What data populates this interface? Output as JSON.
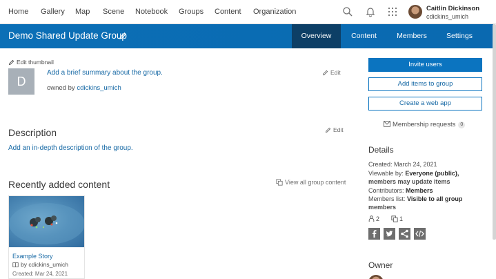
{
  "nav": {
    "links": [
      "Home",
      "Gallery",
      "Map",
      "Scene",
      "Notebook",
      "Groups",
      "Content",
      "Organization"
    ],
    "user_name": "Caitlin Dickinson",
    "user_id": "cdickins_umich"
  },
  "group": {
    "title": "Demo Shared Update Group",
    "tabs": [
      "Overview",
      "Content",
      "Members",
      "Settings"
    ],
    "active_tab": "Overview"
  },
  "overview": {
    "edit_thumbnail": "Edit thumbnail",
    "thumbnail_letter": "D",
    "summary_link": "Add a brief summary about the group.",
    "owned_by_label": "owned by",
    "owner_id": "cdickins_umich",
    "edit_label": "Edit",
    "description_title": "Description",
    "description_link": "Add an in-depth description of the group.",
    "recent_title": "Recently added content",
    "view_all": "View all group content"
  },
  "content_card": {
    "title": "Example Story",
    "by": "by cdickins_umich",
    "created": "Created: Mar 24, 2021"
  },
  "actions": {
    "invite_users": "Invite users",
    "add_items": "Add items to group",
    "create_web_app": "Create a web app",
    "membership_requests": "Membership requests",
    "membership_count": "0"
  },
  "details": {
    "title": "Details",
    "created": "Created: March 24, 2021",
    "viewable_label": "Viewable by:",
    "viewable_value": "Everyone (public),",
    "viewable_value_2": "members may update items",
    "contributors_label": "Contributors:",
    "contributors_value": "Members",
    "members_list_label": "Members list:",
    "members_list_value": "Visible to all group",
    "members_list_value_2": "members",
    "member_count": "2",
    "item_count": "1",
    "share_icons": [
      "facebook-icon",
      "twitter-icon",
      "share-icon",
      "embed-icon"
    ]
  },
  "owner": {
    "title": "Owner"
  },
  "colors": {
    "header_blue": "#0b6fb6",
    "active_tab": "#0d3f66",
    "link_blue": "#1769a5",
    "button_blue": "#0b74c0"
  }
}
